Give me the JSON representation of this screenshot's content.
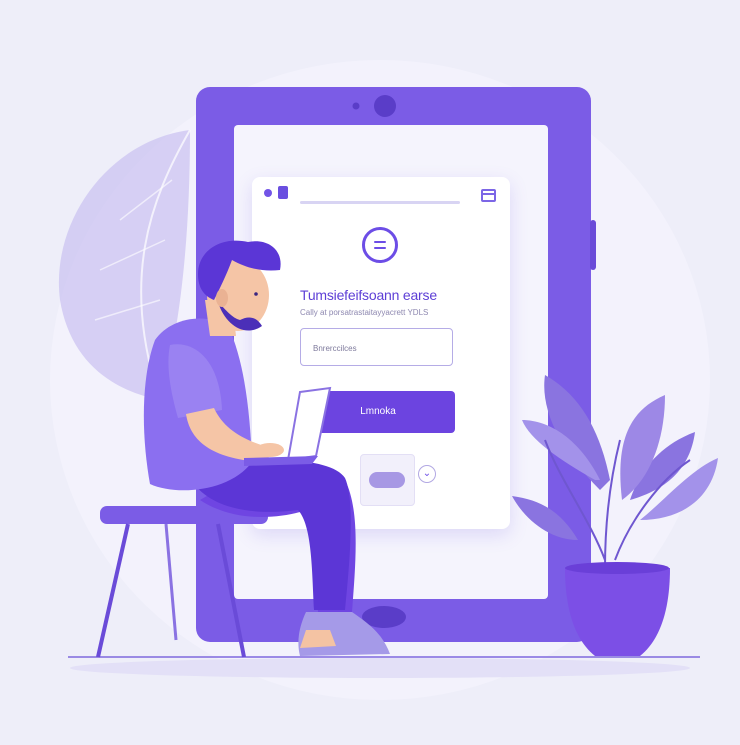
{
  "form": {
    "title": "Tumsiefeifsoann earse",
    "subtitle": "Cally at  porsatrastaitayyacrett  YDLS",
    "input_placeholder": "Bnrerccilces",
    "submit_label": "Lmnoka",
    "chevron_glyph": "⌄"
  },
  "colors": {
    "background": "#eeeef9",
    "tablet_frame": "#7b5ce6",
    "accent": "#6c44e0",
    "plant_pot": "#7c4fe6",
    "leaves": "#8f79e0"
  },
  "icons": {
    "menu": "menu-circle-icon",
    "window": "window-icon",
    "chevron": "chevron-down-icon",
    "camera": "camera-icon"
  }
}
